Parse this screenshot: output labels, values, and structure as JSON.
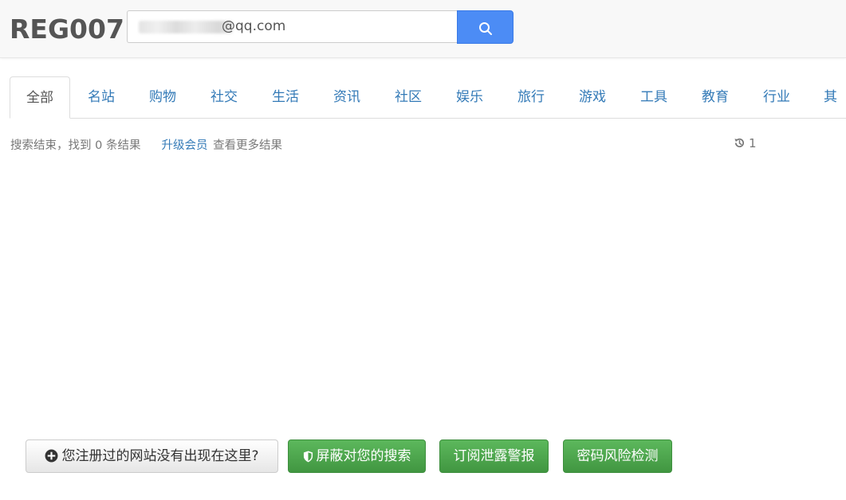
{
  "header": {
    "logo": "REG007",
    "search": {
      "value_visible_suffix": "@qq.com"
    }
  },
  "tabs": [
    {
      "label": "全部",
      "active": true
    },
    {
      "label": "名站"
    },
    {
      "label": "购物"
    },
    {
      "label": "社交"
    },
    {
      "label": "生活"
    },
    {
      "label": "资讯"
    },
    {
      "label": "社区"
    },
    {
      "label": "娱乐"
    },
    {
      "label": "旅行"
    },
    {
      "label": "游戏"
    },
    {
      "label": "工具"
    },
    {
      "label": "教育"
    },
    {
      "label": "行业"
    },
    {
      "label": "其它"
    }
  ],
  "status": {
    "result_text": "搜索结束，找到 0 条结果",
    "upgrade_link": "升级会员",
    "more_text": "查看更多结果",
    "history_count": "1"
  },
  "actions": {
    "missing_site": "您注册过的网站没有出现在这里?",
    "block_search": "屏蔽对您的搜索",
    "subscribe_alert": "订阅泄露警报",
    "password_check": "密码风险检测"
  },
  "colors": {
    "link": "#337ab7",
    "search_button": "#4c8cf5",
    "success_button": "#5cb85c"
  }
}
